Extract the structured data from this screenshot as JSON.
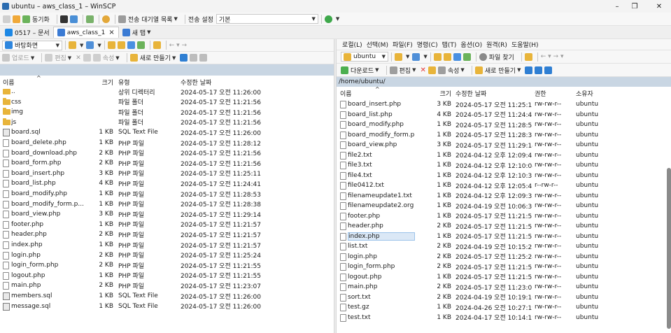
{
  "window": {
    "title": "ubuntu – aws_class_1 – WinSCP",
    "minimize": "–",
    "maximize": "❐",
    "close": "✕"
  },
  "toolbar1": {
    "sync": "동기화",
    "queue": "전송 대기열 목록",
    "transfer_label": "전송 설정",
    "transfer_value": "기본"
  },
  "tabs": [
    {
      "label": "0517 – 문서"
    },
    {
      "label": "aws_class_1"
    },
    {
      "label": "새 탭"
    }
  ],
  "tab_close": "×",
  "menu": [
    "로컬(L)",
    "선택(M)",
    "파일(F)",
    "명령(C)",
    "탭(T)",
    "옵션(O)",
    "원격(R)",
    "도움말(H)"
  ],
  "left": {
    "location": "바탕화면",
    "toolbar": {
      "upload": "업로드",
      "edit": "편집",
      "props": "속성",
      "newitem": "새로 만들기"
    },
    "columns": {
      "name": "이름",
      "size": "크기",
      "type": "유형",
      "modified": "수정한 날짜"
    },
    "files": [
      {
        "name": "..",
        "size": "",
        "type": "상위 디렉터리",
        "date": "2024-05-17 오전 11:26:00",
        "kind": "up"
      },
      {
        "name": "css",
        "size": "",
        "type": "파일 폴더",
        "date": "2024-05-17 오전 11:21:56",
        "kind": "folder"
      },
      {
        "name": "img",
        "size": "",
        "type": "파일 폴더",
        "date": "2024-05-17 오전 11:21:56",
        "kind": "folder"
      },
      {
        "name": "js",
        "size": "",
        "type": "파일 폴더",
        "date": "2024-05-17 오전 11:21:56",
        "kind": "folder"
      },
      {
        "name": "board.sql",
        "size": "1 KB",
        "type": "SQL Text File",
        "date": "2024-05-17 오전 11:26:00",
        "kind": "sql"
      },
      {
        "name": "board_delete.php",
        "size": "1 KB",
        "type": "PHP 파일",
        "date": "2024-05-17 오전 11:28:12",
        "kind": "file"
      },
      {
        "name": "board_download.php",
        "size": "2 KB",
        "type": "PHP 파일",
        "date": "2024-05-17 오전 11:21:56",
        "kind": "file"
      },
      {
        "name": "board_form.php",
        "size": "2 KB",
        "type": "PHP 파일",
        "date": "2024-05-17 오전 11:21:56",
        "kind": "file"
      },
      {
        "name": "board_insert.php",
        "size": "3 KB",
        "type": "PHP 파일",
        "date": "2024-05-17 오전 11:25:11",
        "kind": "file"
      },
      {
        "name": "board_list.php",
        "size": "4 KB",
        "type": "PHP 파일",
        "date": "2024-05-17 오전 11:24:41",
        "kind": "file"
      },
      {
        "name": "board_modify.php",
        "size": "1 KB",
        "type": "PHP 파일",
        "date": "2024-05-17 오전 11:28:53",
        "kind": "file"
      },
      {
        "name": "board_modify_form.p...",
        "size": "1 KB",
        "type": "PHP 파일",
        "date": "2024-05-17 오전 11:28:38",
        "kind": "file"
      },
      {
        "name": "board_view.php",
        "size": "3 KB",
        "type": "PHP 파일",
        "date": "2024-05-17 오전 11:29:14",
        "kind": "file"
      },
      {
        "name": "footer.php",
        "size": "1 KB",
        "type": "PHP 파일",
        "date": "2024-05-17 오전 11:21:57",
        "kind": "file"
      },
      {
        "name": "header.php",
        "size": "2 KB",
        "type": "PHP 파일",
        "date": "2024-05-17 오전 11:21:57",
        "kind": "file"
      },
      {
        "name": "index.php",
        "size": "1 KB",
        "type": "PHP 파일",
        "date": "2024-05-17 오전 11:21:57",
        "kind": "file"
      },
      {
        "name": "login.php",
        "size": "2 KB",
        "type": "PHP 파일",
        "date": "2024-05-17 오전 11:25:24",
        "kind": "file"
      },
      {
        "name": "login_form.php",
        "size": "2 KB",
        "type": "PHP 파일",
        "date": "2024-05-17 오전 11:21:55",
        "kind": "file"
      },
      {
        "name": "logout.php",
        "size": "1 KB",
        "type": "PHP 파일",
        "date": "2024-05-17 오전 11:21:55",
        "kind": "file"
      },
      {
        "name": "main.php",
        "size": "2 KB",
        "type": "PHP 파일",
        "date": "2024-05-17 오전 11:23:07",
        "kind": "file"
      },
      {
        "name": "members.sql",
        "size": "1 KB",
        "type": "SQL Text File",
        "date": "2024-05-17 오전 11:26:00",
        "kind": "sql"
      },
      {
        "name": "message.sql",
        "size": "1 KB",
        "type": "SQL Text File",
        "date": "2024-05-17 오전 11:26:00",
        "kind": "sql"
      }
    ]
  },
  "right": {
    "location": "ubuntu",
    "find": "파일 찾기",
    "toolbar": {
      "download": "다운로드",
      "edit": "편집",
      "props": "속성",
      "newitem": "새로 만들기"
    },
    "path": "/home/ubuntu/",
    "columns": {
      "name": "이름",
      "size": "크기",
      "modified": "수정한 날짜",
      "rights": "권한",
      "owner": "소유자"
    },
    "files": [
      {
        "name": "board_insert.php",
        "size": "3 KB",
        "date": "2024-05-17 오전 11:25:11",
        "rights": "rw-rw-r--",
        "owner": "ubuntu"
      },
      {
        "name": "board_list.php",
        "size": "4 KB",
        "date": "2024-05-17 오전 11:24:41",
        "rights": "rw-rw-r--",
        "owner": "ubuntu"
      },
      {
        "name": "board_modify.php",
        "size": "1 KB",
        "date": "2024-05-17 오전 11:28:53",
        "rights": "rw-rw-r--",
        "owner": "ubuntu"
      },
      {
        "name": "board_modify_form.p...",
        "size": "1 KB",
        "date": "2024-05-17 오전 11:28:38",
        "rights": "rw-rw-r--",
        "owner": "ubuntu"
      },
      {
        "name": "board_view.php",
        "size": "3 KB",
        "date": "2024-05-17 오전 11:29:14",
        "rights": "rw-rw-r--",
        "owner": "ubuntu"
      },
      {
        "name": "file2.txt",
        "size": "1 KB",
        "date": "2024-04-12 오후 12:09:45",
        "rights": "rw-rw-r--",
        "owner": "ubuntu"
      },
      {
        "name": "file3.txt",
        "size": "1 KB",
        "date": "2024-04-12 오후 12:10:04",
        "rights": "rw-rw-r--",
        "owner": "ubuntu"
      },
      {
        "name": "file4.txt",
        "size": "1 KB",
        "date": "2024-04-12 오후 12:10:37",
        "rights": "rw-rw-r--",
        "owner": "ubuntu"
      },
      {
        "name": "file0412.txt",
        "size": "1 KB",
        "date": "2024-04-12 오후 12:05:45",
        "rights": "r--rw-r--",
        "owner": "ubuntu"
      },
      {
        "name": "filenameupdate1.txt",
        "size": "1 KB",
        "date": "2024-04-12 오후 12:09:32",
        "rights": "rw-rw-r--",
        "owner": "ubuntu"
      },
      {
        "name": "filenameupdate2.org",
        "size": "1 KB",
        "date": "2024-04-19 오전 10:06:36",
        "rights": "rw-rw-r--",
        "owner": "ubuntu"
      },
      {
        "name": "footer.php",
        "size": "1 KB",
        "date": "2024-05-17 오전 11:21:57",
        "rights": "rw-rw-r--",
        "owner": "ubuntu"
      },
      {
        "name": "header.php",
        "size": "2 KB",
        "date": "2024-05-17 오전 11:21:57",
        "rights": "rw-rw-r--",
        "owner": "ubuntu"
      },
      {
        "name": "index.php",
        "size": "1 KB",
        "date": "2024-05-17 오전 11:21:57",
        "rights": "rw-rw-r--",
        "owner": "ubuntu",
        "selected": true
      },
      {
        "name": "list.txt",
        "size": "2 KB",
        "date": "2024-04-19 오전 10:15:25",
        "rights": "rw-rw-r--",
        "owner": "ubuntu"
      },
      {
        "name": "login.php",
        "size": "2 KB",
        "date": "2024-05-17 오전 11:25:24",
        "rights": "rw-rw-r--",
        "owner": "ubuntu"
      },
      {
        "name": "login_form.php",
        "size": "2 KB",
        "date": "2024-05-17 오전 11:21:55",
        "rights": "rw-rw-r--",
        "owner": "ubuntu"
      },
      {
        "name": "logout.php",
        "size": "1 KB",
        "date": "2024-05-17 오전 11:21:55",
        "rights": "rw-rw-r--",
        "owner": "ubuntu"
      },
      {
        "name": "main.php",
        "size": "2 KB",
        "date": "2024-05-17 오전 11:23:07",
        "rights": "rw-rw-r--",
        "owner": "ubuntu"
      },
      {
        "name": "sort.txt",
        "size": "2 KB",
        "date": "2024-04-19 오전 10:19:10",
        "rights": "rw-rw-r--",
        "owner": "ubuntu"
      },
      {
        "name": "test.gz",
        "size": "1 KB",
        "date": "2024-04-26 오전 10:27:19",
        "rights": "rw-rw-r--",
        "owner": "ubuntu"
      },
      {
        "name": "test.txt",
        "size": "1 KB",
        "date": "2024-04-17 오전 10:14:19",
        "rights": "rw-rw-r--",
        "owner": "ubuntu"
      }
    ]
  }
}
